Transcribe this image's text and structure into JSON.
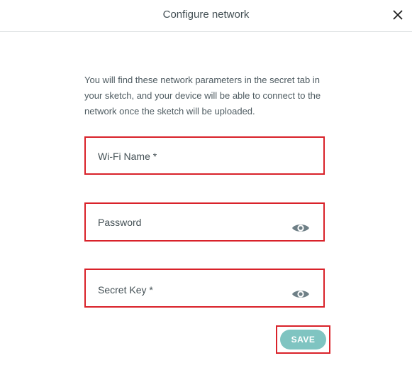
{
  "dialog": {
    "title": "Configure network",
    "description": "You will find these network parameters in the secret tab in your sketch, and your device will be able to connect to the network once the sketch will be uploaded.",
    "close_icon": "close-icon"
  },
  "form": {
    "wifi_name": {
      "label": "Wi-Fi Name *",
      "value": ""
    },
    "password": {
      "label": "Password",
      "value": "",
      "toggle_icon": "eye-icon"
    },
    "secret_key": {
      "label": "Secret Key *",
      "value": "",
      "toggle_icon": "eye-icon"
    },
    "save_label": "SAVE"
  },
  "colors": {
    "highlight_border": "#d9222a",
    "save_button": "#7fc4c1",
    "text": "#434f54",
    "eye_icon": "#6e7f86"
  }
}
